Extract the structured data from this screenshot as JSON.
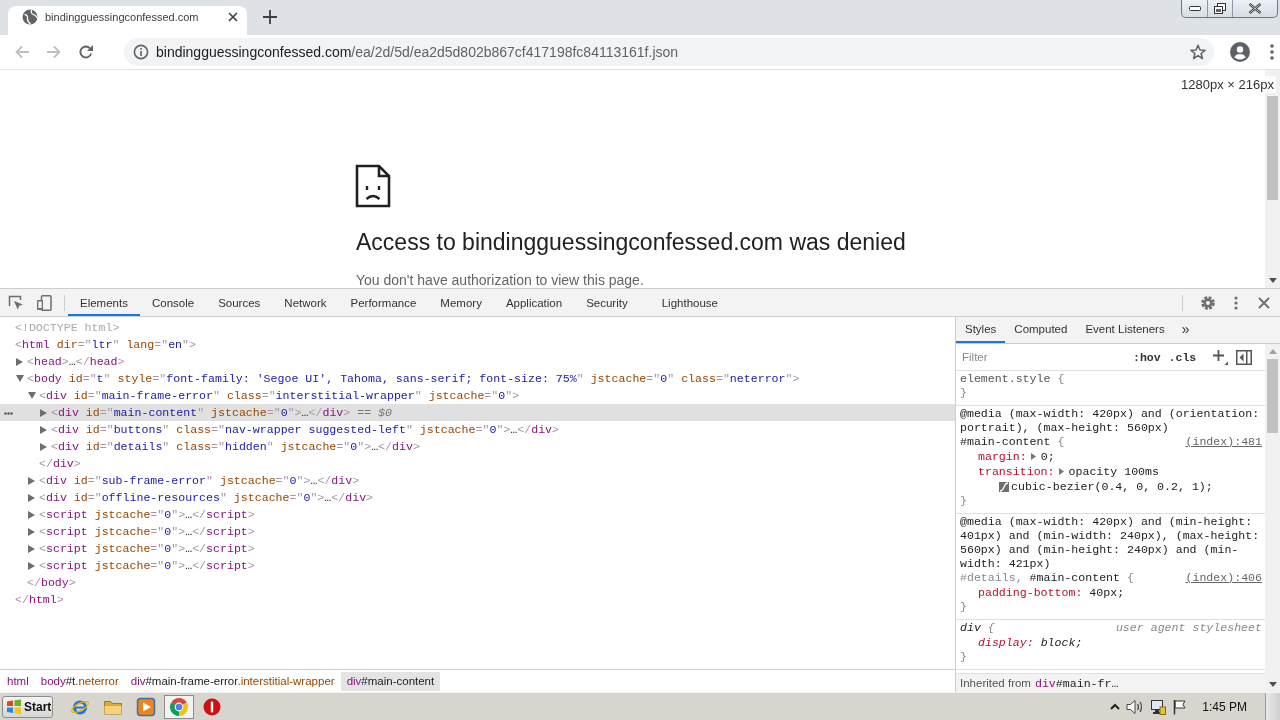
{
  "browser": {
    "tabs": [
      {
        "title": "bindingguessingconfessed.com",
        "selected": true
      }
    ],
    "toolbar": [
      {
        "kind": "back",
        "disabled": true
      },
      {
        "kind": "forward",
        "disabled": true
      },
      {
        "kind": "reload",
        "disabled": false
      }
    ],
    "address": {
      "host": "bindingguessingconfessed.com",
      "path": "/ea/2d/5d/ea2d5d802b867cf417198fc84113161f.json"
    }
  },
  "page": {
    "size_overlay": "1280px × 216px",
    "heading": "Access to bindingguessingconfessed.com was denied",
    "message": "You don't have authorization to view this page."
  },
  "devtools": {
    "tabs": [
      {
        "label": "Elements",
        "selected": true
      },
      {
        "label": "Console",
        "selected": false
      },
      {
        "label": "Sources",
        "selected": false
      },
      {
        "label": "Network",
        "selected": false
      },
      {
        "label": "Performance",
        "selected": false
      },
      {
        "label": "Memory",
        "selected": false
      },
      {
        "label": "Application",
        "selected": false
      },
      {
        "label": "Security",
        "selected": false
      },
      {
        "label": "Lighthouse",
        "selected": false
      }
    ],
    "elements": {
      "nodes": [
        {
          "tokens": [
            {
              "kind": "doctype",
              "text": "<!DOCTYPE html>"
            }
          ],
          "selected": false
        },
        {
          "tokens": [
            {
              "kind": "punct",
              "text": "<"
            },
            {
              "kind": "tag",
              "text": "html"
            },
            {
              "kind": "attr",
              "text": " dir"
            },
            {
              "kind": "punct",
              "text": "=\""
            },
            {
              "kind": "value",
              "text": "ltr"
            },
            {
              "kind": "punct",
              "text": "\""
            },
            {
              "kind": "attr",
              "text": " lang"
            },
            {
              "kind": "punct",
              "text": "=\""
            },
            {
              "kind": "value",
              "text": "en"
            },
            {
              "kind": "punct",
              "text": "\">"
            }
          ],
          "selected": false,
          "children": [
            {
              "tokens": [
                {
                  "kind": "punct",
                  "text": "<"
                },
                {
                  "kind": "tag",
                  "text": "head"
                },
                {
                  "kind": "punct",
                  "text": ">"
                },
                {
                  "kind": "text",
                  "text": "…"
                },
                {
                  "kind": "punct",
                  "text": "</"
                },
                {
                  "kind": "tag",
                  "text": "head"
                },
                {
                  "kind": "punct",
                  "text": ">"
                }
              ],
              "expanded": false,
              "selected": false
            },
            {
              "tokens": [
                {
                  "kind": "punct",
                  "text": "<"
                },
                {
                  "kind": "tag",
                  "text": "body"
                },
                {
                  "kind": "attr",
                  "text": " id"
                },
                {
                  "kind": "punct",
                  "text": "=\""
                },
                {
                  "kind": "value",
                  "text": "t"
                },
                {
                  "kind": "punct",
                  "text": "\""
                },
                {
                  "kind": "attr",
                  "text": " style"
                },
                {
                  "kind": "punct",
                  "text": "=\""
                },
                {
                  "kind": "value",
                  "text": "font-family: 'Segoe UI', Tahoma, sans-serif; font-size: 75%"
                },
                {
                  "kind": "punct",
                  "text": "\""
                },
                {
                  "kind": "attr",
                  "text": " jstcache"
                },
                {
                  "kind": "punct",
                  "text": "=\""
                },
                {
                  "kind": "value",
                  "text": "0"
                },
                {
                  "kind": "punct",
                  "text": "\""
                },
                {
                  "kind": "attr",
                  "text": " class"
                },
                {
                  "kind": "punct",
                  "text": "=\""
                },
                {
                  "kind": "value",
                  "text": "neterror"
                },
                {
                  "kind": "punct",
                  "text": "\">"
                }
              ],
              "expanded": true,
              "selected": false,
              "children": [
                {
                  "tokens": [
                    {
                      "kind": "punct",
                      "text": "<"
                    },
                    {
                      "kind": "tag",
                      "text": "div"
                    },
                    {
                      "kind": "attr",
                      "text": " id"
                    },
                    {
                      "kind": "punct",
                      "text": "=\""
                    },
                    {
                      "kind": "value",
                      "text": "main-frame-error"
                    },
                    {
                      "kind": "punct",
                      "text": "\""
                    },
                    {
                      "kind": "attr",
                      "text": " class"
                    },
                    {
                      "kind": "punct",
                      "text": "=\""
                    },
                    {
                      "kind": "value",
                      "text": "interstitial-wrapper"
                    },
                    {
                      "kind": "punct",
                      "text": "\""
                    },
                    {
                      "kind": "attr",
                      "text": " jstcache"
                    },
                    {
                      "kind": "punct",
                      "text": "=\""
                    },
                    {
                      "kind": "value",
                      "text": "0"
                    },
                    {
                      "kind": "punct",
                      "text": "\">"
                    }
                  ],
                  "expanded": true,
                  "selected": false,
                  "children": [
                    {
                      "tokens": [
                        {
                          "kind": "punct",
                          "text": "<"
                        },
                        {
                          "kind": "tag",
                          "text": "div"
                        },
                        {
                          "kind": "attr",
                          "text": " id"
                        },
                        {
                          "kind": "punct",
                          "text": "=\""
                        },
                        {
                          "kind": "value",
                          "text": "main-content"
                        },
                        {
                          "kind": "punct",
                          "text": "\""
                        },
                        {
                          "kind": "attr",
                          "text": " jstcache"
                        },
                        {
                          "kind": "punct",
                          "text": "=\""
                        },
                        {
                          "kind": "value",
                          "text": "0"
                        },
                        {
                          "kind": "punct",
                          "text": "\">"
                        },
                        {
                          "kind": "text",
                          "text": "…"
                        },
                        {
                          "kind": "punct",
                          "text": "</"
                        },
                        {
                          "kind": "tag",
                          "text": "div"
                        },
                        {
                          "kind": "punct",
                          "text": ">"
                        },
                        {
                          "kind": "hint",
                          "text": " == $0"
                        }
                      ],
                      "expanded": false,
                      "selected": true
                    },
                    {
                      "tokens": [
                        {
                          "kind": "punct",
                          "text": "<"
                        },
                        {
                          "kind": "tag",
                          "text": "div"
                        },
                        {
                          "kind": "attr",
                          "text": " id"
                        },
                        {
                          "kind": "punct",
                          "text": "=\""
                        },
                        {
                          "kind": "value",
                          "text": "buttons"
                        },
                        {
                          "kind": "punct",
                          "text": "\""
                        },
                        {
                          "kind": "attr",
                          "text": " class"
                        },
                        {
                          "kind": "punct",
                          "text": "=\""
                        },
                        {
                          "kind": "value",
                          "text": "nav-wrapper suggested-left"
                        },
                        {
                          "kind": "punct",
                          "text": "\""
                        },
                        {
                          "kind": "attr",
                          "text": " jstcache"
                        },
                        {
                          "kind": "punct",
                          "text": "=\""
                        },
                        {
                          "kind": "value",
                          "text": "0"
                        },
                        {
                          "kind": "punct",
                          "text": "\">"
                        },
                        {
                          "kind": "text",
                          "text": "…"
                        },
                        {
                          "kind": "punct",
                          "text": "</"
                        },
                        {
                          "kind": "tag",
                          "text": "div"
                        },
                        {
                          "kind": "punct",
                          "text": ">"
                        }
                      ],
                      "expanded": false,
                      "selected": false
                    },
                    {
                      "tokens": [
                        {
                          "kind": "punct",
                          "text": "<"
                        },
                        {
                          "kind": "tag",
                          "text": "div"
                        },
                        {
                          "kind": "attr",
                          "text": " id"
                        },
                        {
                          "kind": "punct",
                          "text": "=\""
                        },
                        {
                          "kind": "value",
                          "text": "details"
                        },
                        {
                          "kind": "punct",
                          "text": "\""
                        },
                        {
                          "kind": "attr",
                          "text": " class"
                        },
                        {
                          "kind": "punct",
                          "text": "=\""
                        },
                        {
                          "kind": "value",
                          "text": "hidden"
                        },
                        {
                          "kind": "punct",
                          "text": "\""
                        },
                        {
                          "kind": "attr",
                          "text": " jstcache"
                        },
                        {
                          "kind": "punct",
                          "text": "=\""
                        },
                        {
                          "kind": "value",
                          "text": "0"
                        },
                        {
                          "kind": "punct",
                          "text": "\">"
                        },
                        {
                          "kind": "text",
                          "text": "…"
                        },
                        {
                          "kind": "punct",
                          "text": "</"
                        },
                        {
                          "kind": "tag",
                          "text": "div"
                        },
                        {
                          "kind": "punct",
                          "text": ">"
                        }
                      ],
                      "expanded": false,
                      "selected": false
                    }
                  ],
                  "closing": [
                    {
                      "kind": "punct",
                      "text": "</"
                    },
                    {
                      "kind": "tag",
                      "text": "div"
                    },
                    {
                      "kind": "punct",
                      "text": ">"
                    }
                  ]
                },
                {
                  "tokens": [
                    {
                      "kind": "punct",
                      "text": "<"
                    },
                    {
                      "kind": "tag",
                      "text": "div"
                    },
                    {
                      "kind": "attr",
                      "text": " id"
                    },
                    {
                      "kind": "punct",
                      "text": "=\""
                    },
                    {
                      "kind": "value",
                      "text": "sub-frame-error"
                    },
                    {
                      "kind": "punct",
                      "text": "\""
                    },
                    {
                      "kind": "attr",
                      "text": " jstcache"
                    },
                    {
                      "kind": "punct",
                      "text": "=\""
                    },
                    {
                      "kind": "value",
                      "text": "0"
                    },
                    {
                      "kind": "punct",
                      "text": "\">"
                    },
                    {
                      "kind": "text",
                      "text": "…"
                    },
                    {
                      "kind": "punct",
                      "text": "</"
                    },
                    {
                      "kind": "tag",
                      "text": "div"
                    },
                    {
                      "kind": "punct",
                      "text": ">"
                    }
                  ],
                  "expanded": false,
                  "selected": false
                },
                {
                  "tokens": [
                    {
                      "kind": "punct",
                      "text": "<"
                    },
                    {
                      "kind": "tag",
                      "text": "div"
                    },
                    {
                      "kind": "attr",
                      "text": " id"
                    },
                    {
                      "kind": "punct",
                      "text": "=\""
                    },
                    {
                      "kind": "value",
                      "text": "offline-resources"
                    },
                    {
                      "kind": "punct",
                      "text": "\""
                    },
                    {
                      "kind": "attr",
                      "text": " jstcache"
                    },
                    {
                      "kind": "punct",
                      "text": "=\""
                    },
                    {
                      "kind": "value",
                      "text": "0"
                    },
                    {
                      "kind": "punct",
                      "text": "\">"
                    },
                    {
                      "kind": "text",
                      "text": "…"
                    },
                    {
                      "kind": "punct",
                      "text": "</"
                    },
                    {
                      "kind": "tag",
                      "text": "div"
                    },
                    {
                      "kind": "punct",
                      "text": ">"
                    }
                  ],
                  "expanded": false,
                  "selected": false
                },
                {
                  "tokens": [
                    {
                      "kind": "punct",
                      "text": "<"
                    },
                    {
                      "kind": "tag",
                      "text": "script"
                    },
                    {
                      "kind": "attr",
                      "text": " jstcache"
                    },
                    {
                      "kind": "punct",
                      "text": "=\""
                    },
                    {
                      "kind": "value",
                      "text": "0"
                    },
                    {
                      "kind": "punct",
                      "text": "\">"
                    },
                    {
                      "kind": "text",
                      "text": "…"
                    },
                    {
                      "kind": "punct",
                      "text": "</"
                    },
                    {
                      "kind": "tag",
                      "text": "script"
                    },
                    {
                      "kind": "punct",
                      "text": ">"
                    }
                  ],
                  "expanded": false,
                  "selected": false
                },
                {
                  "tokens": [
                    {
                      "kind": "punct",
                      "text": "<"
                    },
                    {
                      "kind": "tag",
                      "text": "script"
                    },
                    {
                      "kind": "attr",
                      "text": " jstcache"
                    },
                    {
                      "kind": "punct",
                      "text": "=\""
                    },
                    {
                      "kind": "value",
                      "text": "0"
                    },
                    {
                      "kind": "punct",
                      "text": "\">"
                    },
                    {
                      "kind": "text",
                      "text": "…"
                    },
                    {
                      "kind": "punct",
                      "text": "</"
                    },
                    {
                      "kind": "tag",
                      "text": "script"
                    },
                    {
                      "kind": "punct",
                      "text": ">"
                    }
                  ],
                  "expanded": false,
                  "selected": false
                },
                {
                  "tokens": [
                    {
                      "kind": "punct",
                      "text": "<"
                    },
                    {
                      "kind": "tag",
                      "text": "script"
                    },
                    {
                      "kind": "attr",
                      "text": " jstcache"
                    },
                    {
                      "kind": "punct",
                      "text": "=\""
                    },
                    {
                      "kind": "value",
                      "text": "0"
                    },
                    {
                      "kind": "punct",
                      "text": "\">"
                    },
                    {
                      "kind": "text",
                      "text": "…"
                    },
                    {
                      "kind": "punct",
                      "text": "</"
                    },
                    {
                      "kind": "tag",
                      "text": "script"
                    },
                    {
                      "kind": "punct",
                      "text": ">"
                    }
                  ],
                  "expanded": false,
                  "selected": false
                },
                {
                  "tokens": [
                    {
                      "kind": "punct",
                      "text": "<"
                    },
                    {
                      "kind": "tag",
                      "text": "script"
                    },
                    {
                      "kind": "attr",
                      "text": " jstcache"
                    },
                    {
                      "kind": "punct",
                      "text": "=\""
                    },
                    {
                      "kind": "value",
                      "text": "0"
                    },
                    {
                      "kind": "punct",
                      "text": "\">"
                    },
                    {
                      "kind": "text",
                      "text": "…"
                    },
                    {
                      "kind": "punct",
                      "text": "</"
                    },
                    {
                      "kind": "tag",
                      "text": "script"
                    },
                    {
                      "kind": "punct",
                      "text": ">"
                    }
                  ],
                  "expanded": false,
                  "selected": false
                }
              ],
              "closing": [
                {
                  "kind": "punct",
                  "text": "</"
                },
                {
                  "kind": "tag",
                  "text": "body"
                },
                {
                  "kind": "punct",
                  "text": ">"
                }
              ]
            }
          ],
          "closing": [
            {
              "kind": "punct",
              "text": "</"
            },
            {
              "kind": "tag",
              "text": "html"
            },
            {
              "kind": "punct",
              "text": ">"
            }
          ]
        }
      ]
    },
    "breadcrumbs": [
      {
        "tag": "html",
        "selected": false
      },
      {
        "tag": "body",
        "id": "#t",
        "classes": ".neterror",
        "selected": false
      },
      {
        "tag": "div",
        "id": "#main-frame-error",
        "classes": ".interstitial-wrapper",
        "selected": false
      },
      {
        "tag": "div",
        "id": "#main-content",
        "selected": true
      }
    ],
    "styles": {
      "tabs": [
        {
          "label": "Styles",
          "selected": true
        },
        {
          "label": "Computed",
          "selected": false
        },
        {
          "label": "Event Listeners",
          "selected": false
        }
      ],
      "more_tabs": "»",
      "filter": {
        "placeholder": "Filter"
      },
      "state_toggle": ":hov",
      "class_toggle": ".cls",
      "rules": [
        {
          "kind": "inline",
          "selectors": [
            {
              "text": "element.style",
              "matched": true
            }
          ],
          "open": "{",
          "close": "}"
        },
        {
          "kind": "author",
          "media": "@media (max-width: 420px) and (orientation: portrait), (max-height: 560px)",
          "selectors": [
            {
              "text": "#main-content",
              "matched": true
            }
          ],
          "open": "{",
          "source": "(index):481",
          "properties": [
            {
              "name": "margin:",
              "expandable": true,
              "value": "0;"
            },
            {
              "name": "transition:",
              "expandable": true,
              "value": "opacity 100ms",
              "easing": "cubic-bezier(0.4, 0, 0.2, 1);"
            }
          ],
          "close": "}"
        },
        {
          "kind": "author",
          "media": "@media (max-width: 420px) and (min-height: 401px) and (min-width: 240px), (max-height: 560px) and (min-height: 240px) and (min-width: 421px)",
          "selectors": [
            {
              "text": "#details,",
              "matched": false
            },
            {
              "text": "#main-content",
              "matched": true
            }
          ],
          "open": "{",
          "source": "(index):406",
          "properties": [
            {
              "name": "padding-bottom:",
              "expandable": false,
              "value": "40px;"
            }
          ],
          "close": "}"
        },
        {
          "kind": "user-agent",
          "selectors": [
            {
              "text": "div",
              "matched": true
            }
          ],
          "open": "{",
          "source": "user agent stylesheet",
          "properties": [
            {
              "name": "display:",
              "expandable": false,
              "value": "block;"
            }
          ],
          "close": "}"
        }
      ],
      "inherited": {
        "label": "Inherited from",
        "tag": "div",
        "rest": "#main-fr…"
      }
    }
  },
  "taskbar": {
    "start": "Start",
    "apps": [
      {
        "kind": "e-logo",
        "selected": false
      },
      {
        "kind": "folder",
        "selected": false
      },
      {
        "kind": "player",
        "selected": false
      },
      {
        "kind": "browser",
        "selected": true
      },
      {
        "kind": "alert",
        "selected": false
      }
    ],
    "clock": "1:45 PM"
  }
}
